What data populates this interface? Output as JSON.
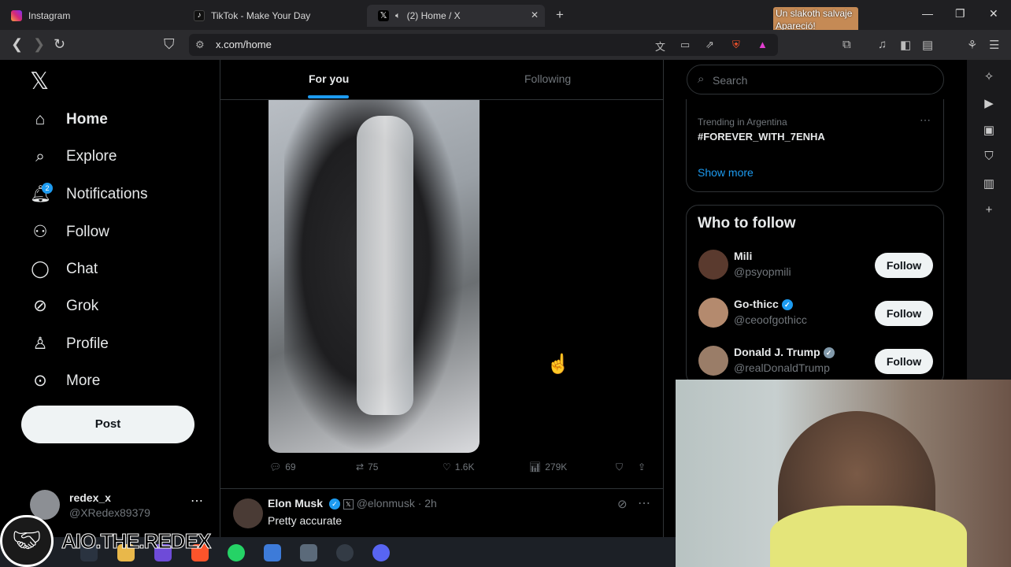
{
  "browser": {
    "tabs": [
      {
        "title": "Instagram",
        "icon": "instagram-icon"
      },
      {
        "title": "TikTok - Make Your Day",
        "icon": "tiktok-icon"
      },
      {
        "title": "(2) Home / X",
        "icon": "x-icon",
        "active": true
      }
    ],
    "url": "x.com/home"
  },
  "overlay_notification": {
    "line1": "Un slakoth salvaje",
    "line2": "Apareció!"
  },
  "nav": {
    "items": [
      {
        "label": "Home",
        "icon": "home-icon"
      },
      {
        "label": "Explore",
        "icon": "search-icon"
      },
      {
        "label": "Notifications",
        "icon": "bell-icon",
        "badge": "2"
      },
      {
        "label": "Follow",
        "icon": "person-add-icon"
      },
      {
        "label": "Chat",
        "icon": "chat-icon"
      },
      {
        "label": "Grok",
        "icon": "grok-icon"
      },
      {
        "label": "Profile",
        "icon": "person-icon"
      },
      {
        "label": "More",
        "icon": "more-circle-icon"
      }
    ],
    "post_label": "Post",
    "account": {
      "name": "redex_x",
      "handle": "@XRedex89379"
    }
  },
  "feed": {
    "tabs": [
      {
        "label": "For you"
      },
      {
        "label": "Following"
      }
    ],
    "post1": {
      "replies": "69",
      "reposts": "75",
      "likes": "1.6K",
      "views": "279K"
    },
    "post2": {
      "author": "Elon Musk",
      "handle": "@elonmusk",
      "time": "· 2h",
      "text": "Pretty accurate"
    }
  },
  "sidebar": {
    "search_placeholder": "Search",
    "trending": {
      "context": "Trending in Argentina",
      "topic": "#FOREVER_WITH_7ENHA",
      "show_more": "Show more"
    },
    "who_to_follow": {
      "title": "Who to follow",
      "follow_label": "Follow",
      "people": [
        {
          "name": "Mili",
          "handle": "@psyopmili",
          "verified": false
        },
        {
          "name": "Go-thicc",
          "handle": "@ceoofgothicc",
          "verified": true
        },
        {
          "name": "Donald J. Trump",
          "handle": "@realDonaldTrump",
          "verified": true
        }
      ]
    }
  },
  "watermark": {
    "text": "AIO.THE.REDEX"
  },
  "colors": {
    "accent": "#1d9bf0",
    "bg": "#000000",
    "muted": "#71767b"
  }
}
